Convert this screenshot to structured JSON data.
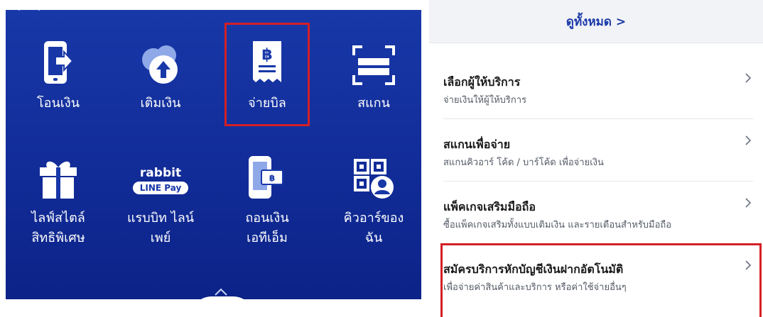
{
  "left_menu": {
    "tiles": [
      {
        "label": "โอนเงิน",
        "icon": "transfer-phone-icon"
      },
      {
        "label": "เติมเงิน",
        "icon": "topup-upload-icon"
      },
      {
        "label": "จ่ายบิล",
        "icon": "bill-receipt-baht-icon"
      },
      {
        "label": "สแกน",
        "icon": "scan-frame-icon"
      },
      {
        "label": "ไลฟ์สไตล์\nสิทธิพิเศษ",
        "icon": "gift-icon"
      },
      {
        "label": "แรบบิท ไลน์\nเพย์",
        "icon": "rabbit-linepay-logo"
      },
      {
        "label": "ถอนเงิน\nเอทีเอ็ม",
        "icon": "atm-withdraw-icon"
      },
      {
        "label": "คิวอาร์ของ\nฉัน",
        "icon": "my-qr-icon"
      }
    ],
    "rabbit_logo": {
      "top": "rabbit",
      "bottom": "LINE Pay"
    }
  },
  "right_panel": {
    "see_all": "ดูทั้งหมด >",
    "items": [
      {
        "title": "เลือกผู้ให้บริการ",
        "subtitle": "จ่ายเงินให้ผู้ให้บริการ"
      },
      {
        "title": "สแกนเพื่อจ่าย",
        "subtitle": "สแกนคิวอาร์ โค้ด / บาร์โค้ด เพื่อจ่ายเงิน"
      },
      {
        "title": "แพ็คเกจเสริมมือถือ",
        "subtitle": "ซื้อแพ็คเกจเสริมทั้งแบบเติมเงิน และรายเดือนสำหรับมือถือ"
      },
      {
        "title": "สมัครบริการหักบัญชีเงินฝากอัตโนมัติ",
        "subtitle": "เพื่อจ่ายค่าสินค้าและบริการ หรือค่าใช้จ่ายอื่นๆ"
      }
    ]
  },
  "colors": {
    "brand_blue": "#1838a8",
    "highlight_red": "#d41f26"
  }
}
